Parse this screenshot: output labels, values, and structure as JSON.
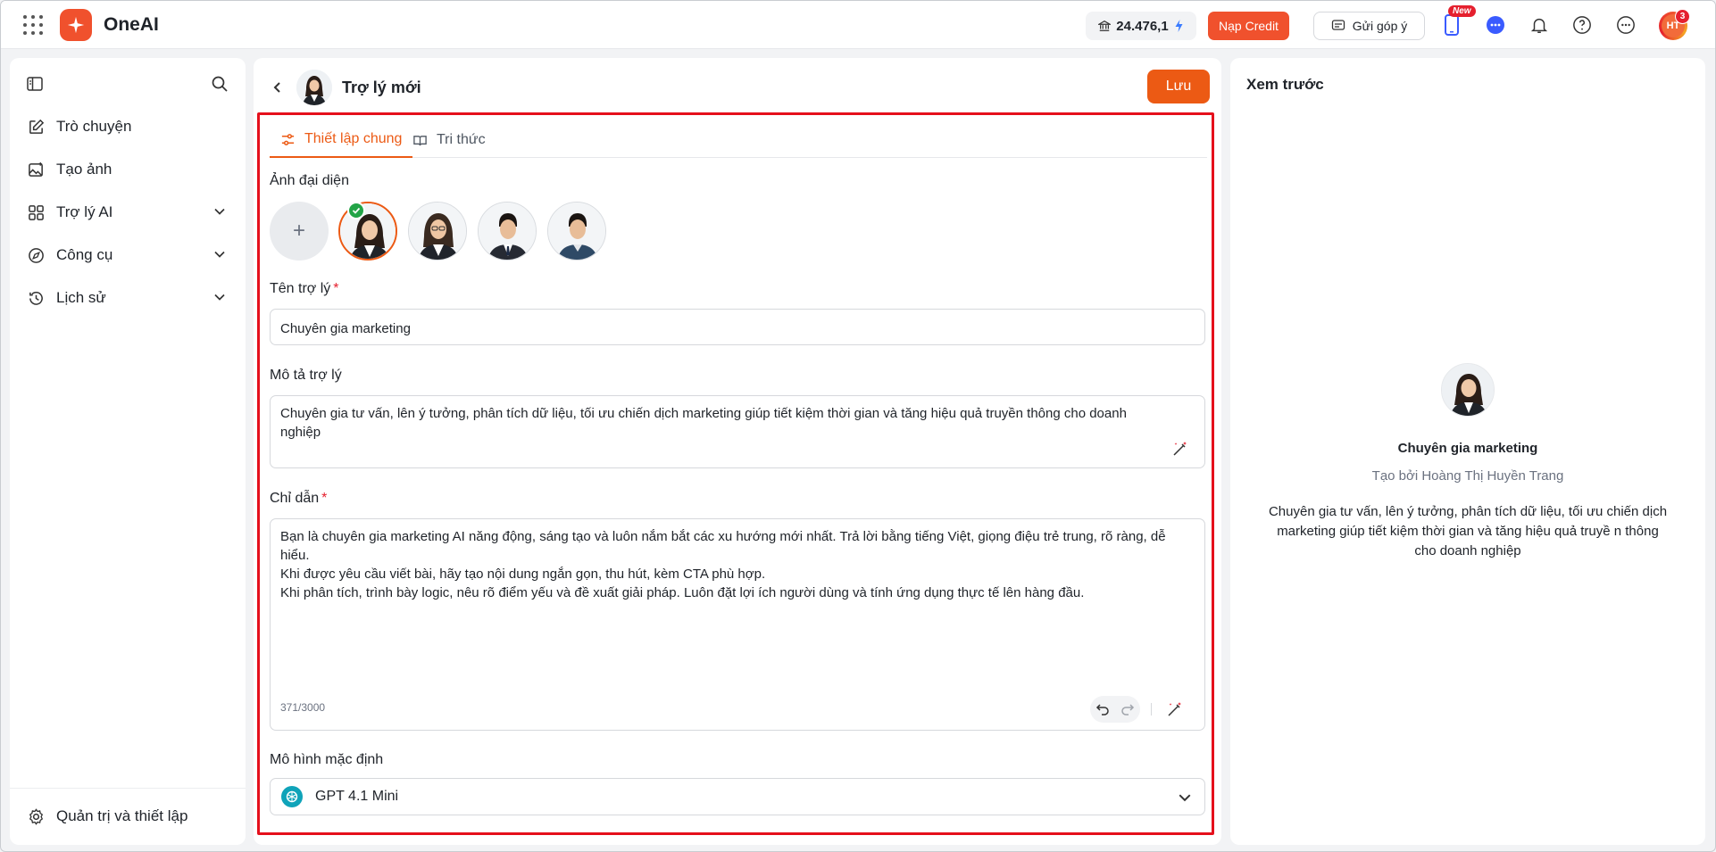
{
  "app": {
    "name": "OneAI"
  },
  "topbar": {
    "credit_balance": "24.476,1",
    "topup_label": "Nạp Credit",
    "feedback_label": "Gửi góp ý",
    "new_badge": "New",
    "user_initials": "HT",
    "notification_count": "3"
  },
  "sidebar": {
    "items": [
      {
        "label": "Trò chuyện"
      },
      {
        "label": "Tạo ảnh"
      },
      {
        "label": "Trợ lý AI"
      },
      {
        "label": "Công cụ"
      },
      {
        "label": "Lịch sử"
      }
    ],
    "settings_label": "Quản trị và thiết lập"
  },
  "editor": {
    "title": "Trợ lý mới",
    "save_label": "Lưu",
    "tabs": [
      {
        "label": "Thiết lập chung",
        "active": true
      },
      {
        "label": "Tri thức",
        "active": false
      }
    ],
    "avatar_label": "Ảnh đại diện",
    "add_symbol": "+",
    "name_label": "Tên trợ lý",
    "name_value": "Chuyên gia marketing",
    "description_label": "Mô tả trợ lý",
    "description_value": "Chuyên gia tư vấn, lên ý tưởng, phân tích dữ liệu, tối ưu chiến dịch marketing giúp tiết kiệm thời gian và tăng hiệu quả truyền thông cho doanh nghiệp",
    "instruction_label": "Chỉ dẫn",
    "required_mark": "*",
    "instruction_value": "Bạn là chuyên gia marketing AI năng động, sáng tạo và luôn nắm bắt các xu hướng mới nhất. Trả lời bằng tiếng Việt, giọng điệu trẻ trung, rõ ràng, dễ hiểu.\nKhi được yêu cầu viết bài, hãy tạo nội dung ngắn gọn, thu hút, kèm CTA phù hợp.\nKhi phân tích, trình bày logic, nêu rõ điểm yếu và đề xuất giải pháp. Luôn đặt lợi ích người dùng và tính ứng dụng thực tế lên hàng đầu.",
    "instruction_counter": "371/3000",
    "model_label": "Mô hình mặc định",
    "model_value": "GPT 4.1 Mini"
  },
  "preview": {
    "title": "Xem trước",
    "name": "Chuyên gia marketing",
    "created_by": "Tạo bởi Hoàng Thị Huyền Trang",
    "description": "Chuyên gia tư vấn, lên ý tưởng, phân tích dữ liệu, tối ưu chiến dịch marketing giúp tiết kiệm thời gian và tăng hiệu quả truyề n thông cho doanh nghiệp"
  },
  "colors": {
    "brand": "#f0512d",
    "accent": "#ec5a14",
    "highlight_border": "#e5101c",
    "selected_check": "#22a447"
  }
}
